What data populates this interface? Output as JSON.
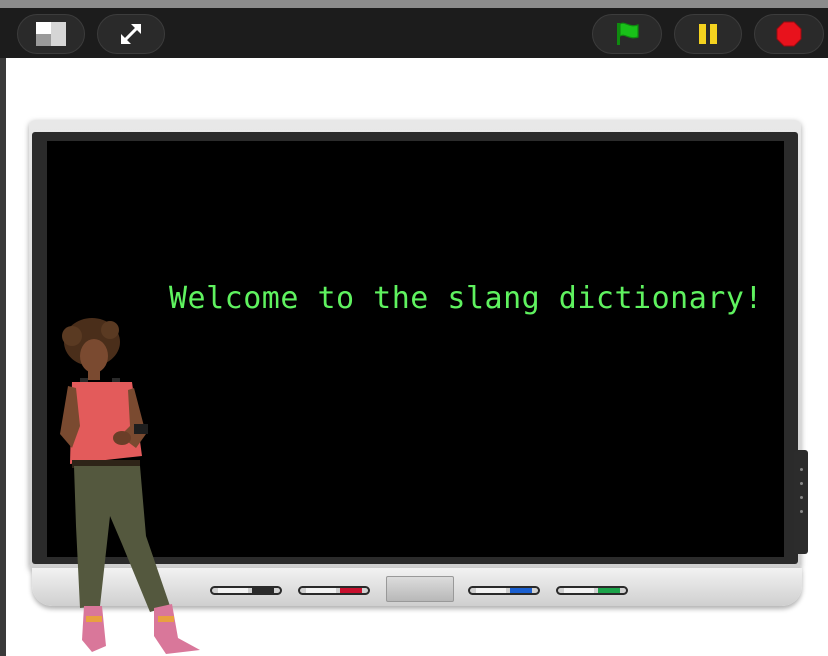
{
  "toolbar": {
    "buttons": [
      {
        "name": "layout-toggle",
        "icon": "small-stage-icon"
      },
      {
        "name": "fullscreen",
        "icon": "fullscreen-arrows-icon"
      },
      {
        "name": "green-flag",
        "icon": "green-flag-icon",
        "color": "#19c119"
      },
      {
        "name": "pause",
        "icon": "pause-icon",
        "color": "#f4d21f"
      },
      {
        "name": "stop",
        "icon": "stop-icon",
        "color": "#e8121c"
      }
    ]
  },
  "stage": {
    "board": {
      "message": "Welcome to the slang dictionary!",
      "message_color": "#5ff25f",
      "pen_colors": [
        "#2a2a2a",
        "#c8102e",
        "#1a5fd0",
        "#1ca34a"
      ]
    },
    "character": {
      "icon": "student-with-backpack-sprite"
    }
  }
}
